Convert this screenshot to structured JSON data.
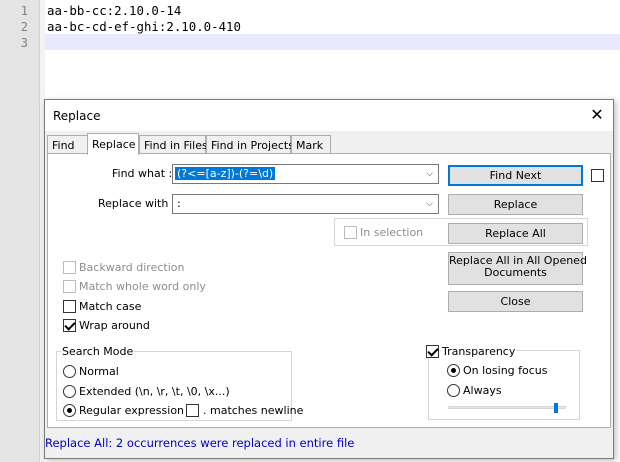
{
  "editor": {
    "line_numbers": [
      "1",
      "2",
      "3"
    ],
    "lines": [
      "aa-bb-cc:2.10.0-14",
      "aa-bc-cd-ef-ghi:2.10.0-410",
      ""
    ]
  },
  "dialog": {
    "title": "Replace",
    "close_glyph": "✕",
    "tabs": [
      "Find",
      "Replace",
      "Find in Files",
      "Find in Projects",
      "Mark"
    ],
    "find_what_label": "Find what :",
    "find_what_value": "(?<=[a-z])-(?=\\d)",
    "replace_with_label": "Replace with :",
    "replace_with_value": ":",
    "combo_arrow": "⌵",
    "in_selection_label": "In selection",
    "buttons": {
      "find_next": "Find Next",
      "replace": "Replace",
      "replace_all": "Replace All",
      "replace_all_opened_line1": "Replace All in All Opened",
      "replace_all_opened_line2": "Documents",
      "close": "Close"
    },
    "options": {
      "backward": "Backward direction",
      "whole_word": "Match whole word only",
      "match_case": "Match case",
      "wrap_around": "Wrap around"
    },
    "search_mode": {
      "title": "Search Mode",
      "normal": "Normal",
      "extended": "Extended (\\n, \\r, \\t, \\0, \\x...)",
      "regex": "Regular expression",
      "matches_newline": ". matches newline",
      "selected": "regex"
    },
    "transparency": {
      "title": "Transparency",
      "on_losing_focus": "On losing focus",
      "always": "Always",
      "level": 0.9
    },
    "status": "Replace All: 2 occurrences were replaced in entire file"
  },
  "colors": {
    "accent": "#0078d7",
    "status_text": "#0000c0",
    "current_line": "#e8e8ff"
  }
}
